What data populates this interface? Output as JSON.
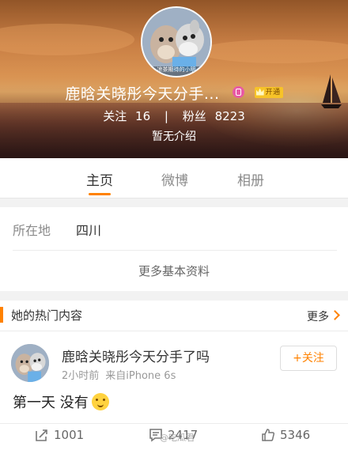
{
  "profile": {
    "name": "鹿晗关晓彤今天分手...",
    "member_badge": "开通",
    "following_label": "关注",
    "following_count": "16",
    "separator": "|",
    "followers_label": "粉丝",
    "followers_count": "8223",
    "intro": "暂无介绍",
    "avatar_text": "凉茶期待的小明"
  },
  "tabs": [
    {
      "label": "主页"
    },
    {
      "label": "微博"
    },
    {
      "label": "相册"
    }
  ],
  "info": {
    "location_label": "所在地",
    "location_value": "四川",
    "more_label": "更多基本资料"
  },
  "hot": {
    "title": "她的热门内容",
    "more_label": "更多"
  },
  "post": {
    "author": "鹿晗关晓彤今天分手了吗",
    "time": "2小时前",
    "source": "来自iPhone 6s",
    "follow_label": "+关注",
    "text": "第一天 没有",
    "repost_count": "1001",
    "comment_count": "2417",
    "like_count": "5346",
    "watermark": "@吃瓜君"
  },
  "colors": {
    "accent": "#ff8200",
    "text_primary": "#333333",
    "text_secondary": "#8a8a8a"
  }
}
